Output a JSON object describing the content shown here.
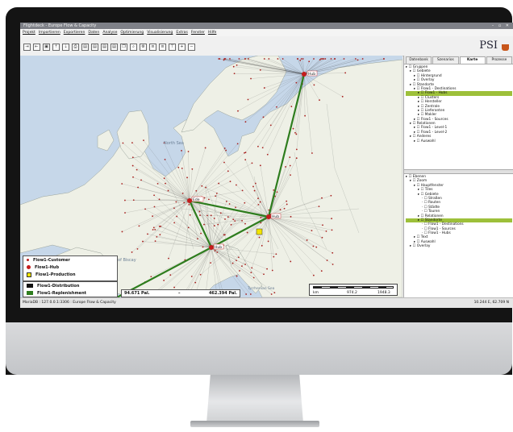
{
  "window": {
    "title": "Flightdeck - Europe Flow & Capacity",
    "controls": "– ▫ ✕"
  },
  "menu": [
    "Projekt",
    "Importieren",
    "Exportieren",
    "Daten",
    "Analyse",
    "Optimierung",
    "Visualisierung",
    "Extras",
    "Fenster",
    "Hilfe"
  ],
  "toolbar": {
    "icons": [
      "import-icon",
      "export-icon",
      "save-icon",
      "upload-icon",
      "download-icon",
      "print-icon",
      "doc-icon",
      "doc-icon",
      "doc-icon",
      "doc-icon",
      "copy-icon",
      "zoom-icon",
      "settings-icon",
      "layers-icon",
      "layers-icon",
      "filter-icon",
      "zoom-in-icon",
      "zoom-out-icon"
    ]
  },
  "brand": {
    "logo": "PSI"
  },
  "map": {
    "labels": {
      "north_sea": "North Sea",
      "bay_of_biscay": "Bay of Biscay",
      "tyrrhenian": "Tyrrhenian Sea"
    },
    "hubs": {
      "hub_a": "Ede",
      "hub_b": "Hub",
      "hub_c": "Hub",
      "hub_d": "Hub"
    },
    "scale": {
      "unit": "km",
      "mid": "974.2",
      "max": "1948.3"
    },
    "stats": {
      "label": "Flow1-Replenishment",
      "left": "94.671 Pal.",
      "sep": "–",
      "right": "462.394 Pal."
    }
  },
  "legend": {
    "items": [
      {
        "label": "Flow1-Customer",
        "color": "#b51f1f"
      },
      {
        "label": "Flow1-Hub",
        "color": "#c41c1c"
      },
      {
        "label": "Flow1-Production",
        "color": "#f2e400"
      }
    ],
    "flows": [
      {
        "label": "Flow1-Distribution",
        "color": "#111111"
      },
      {
        "label": "Flow1-Replenishment",
        "color": "#2e7d1e"
      }
    ]
  },
  "sidebar": {
    "tabs": [
      "Datenbank",
      "Szenarios",
      "Karte",
      "Prozesse"
    ],
    "active_tab": "Karte",
    "tree_top": [
      {
        "label": "Gruppen",
        "indent": 0
      },
      {
        "label": "Gebiete",
        "indent": 1
      },
      {
        "label": "Hintergrund",
        "indent": 2
      },
      {
        "label": "Overlay",
        "indent": 2
      },
      {
        "label": "Standorte",
        "indent": 1
      },
      {
        "label": "Flow1 - Destinations",
        "indent": 2
      },
      {
        "label": "Flow1 - Hubs",
        "indent": 3,
        "selected": true
      },
      {
        "label": "Clusters",
        "indent": 3
      },
      {
        "label": "Hersteller",
        "indent": 3
      },
      {
        "label": "Zentrale",
        "indent": 3
      },
      {
        "label": "Lieferanten",
        "indent": 3
      },
      {
        "label": "Makler",
        "indent": 3
      },
      {
        "label": "Flow1 - Sources",
        "indent": 2
      },
      {
        "label": "Relationen",
        "indent": 1
      },
      {
        "label": "Flow1 - Level-1",
        "indent": 2
      },
      {
        "label": "Flow1 - Level-2",
        "indent": 2
      },
      {
        "label": "Anderes",
        "indent": 1
      },
      {
        "label": "Auswahl",
        "indent": 2
      }
    ],
    "tree_bottom": [
      {
        "label": "Ebenen",
        "indent": 0
      },
      {
        "label": "Zoom",
        "indent": 1
      },
      {
        "label": "Hauptfenster",
        "indent": 2
      },
      {
        "label": "Tiles",
        "indent": 3
      },
      {
        "label": "Gebiete",
        "indent": 3
      },
      {
        "label": "Straßen",
        "indent": 4
      },
      {
        "label": "Routen",
        "indent": 4
      },
      {
        "label": "Städte",
        "indent": 4
      },
      {
        "label": "Touren",
        "indent": 4
      },
      {
        "label": "Relationen",
        "indent": 3
      },
      {
        "label": "Standorte",
        "indent": 3,
        "selected": true
      },
      {
        "label": "Flow1 - Destinations",
        "indent": 4
      },
      {
        "label": "Flow1 - Sources",
        "indent": 4
      },
      {
        "label": "Flow1 - Hubs",
        "indent": 4
      },
      {
        "label": "Text",
        "indent": 2
      },
      {
        "label": "Auswahl",
        "indent": 2
      },
      {
        "label": "Overlay",
        "indent": 1
      }
    ]
  },
  "status": {
    "left": "MariaDB : 127.0.0.1:3306 : Europe Flow & Capacity",
    "right": "10.244 E, 62.709 N"
  }
}
